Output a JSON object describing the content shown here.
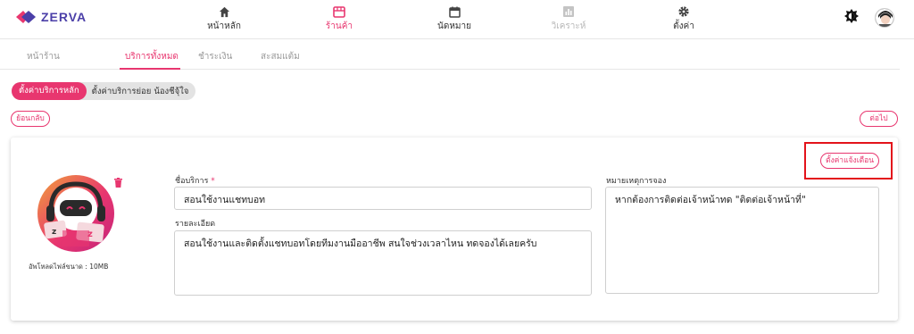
{
  "brand": {
    "name": "ZERVA",
    "accent": "#e8366f",
    "logo_color": "#4b3fa8"
  },
  "nav": [
    {
      "label": "หน้าหลัก",
      "icon": "home-icon"
    },
    {
      "label": "ร้านค้า",
      "icon": "store-icon",
      "active": true
    },
    {
      "label": "นัดหมาย",
      "icon": "calendar-icon"
    },
    {
      "label": "วิเคราะห์",
      "icon": "chart-icon",
      "disabled": true
    },
    {
      "label": "ตั้งค่า",
      "icon": "gear-icon"
    }
  ],
  "subtabs": [
    "หน้าร้าน",
    "บริการทั้งหมด",
    "ชำระเงิน",
    "สะสมแต้ม"
  ],
  "segment": {
    "active": "ตั้งค่าบริการหลัก",
    "inactive": "ตั้งค่าบริการย่อย น้องชีจุ้ใจ"
  },
  "buttons": {
    "back": "ย้อนกลับ",
    "next": "ต่อไป",
    "notify": "ตั้งค่าแจ้งเตือน"
  },
  "upload_note": "อัพโหลดไฟล์ขนาด : 10MB",
  "form": {
    "name_label": "ชื่อบริการ",
    "name_required": "*",
    "name_value": "สอนใช้งานแชทบอท",
    "detail_label": "รายละเอียด",
    "detail_value": "สอนใช้งานและติดตั้งแชทบอทโดยทีมงานมืออาชีพ สนใจช่วงเวลาไหน ทดจองได้เลยครับ",
    "remark_label": "หมายเหตุการจอง",
    "remark_value": "หากต้องการติดต่อเจ้าหน้าทด \"ติดต่อเจ้าหน้าที่\""
  }
}
